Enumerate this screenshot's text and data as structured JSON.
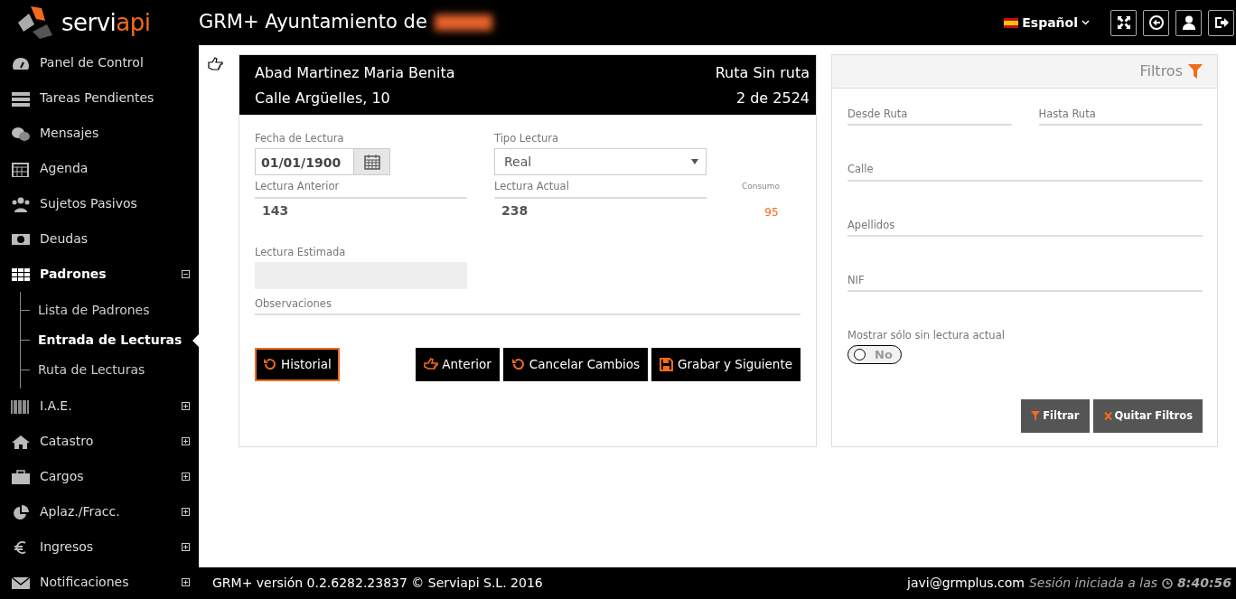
{
  "header": {
    "logo": {
      "part_1": "servi",
      "part_2": "api"
    },
    "title": "GRM+ Ayuntamiento de",
    "language": "Español"
  },
  "sidebar": {
    "items": [
      {
        "label": "Panel de Control",
        "kind": "link"
      },
      {
        "label": "Tareas Pendientes",
        "kind": "link"
      },
      {
        "label": "Mensajes",
        "kind": "link"
      },
      {
        "label": "Agenda",
        "kind": "link"
      },
      {
        "label": "Sujetos Pasivos",
        "kind": "link"
      },
      {
        "label": "Deudas",
        "kind": "link"
      },
      {
        "label": "Padrones",
        "kind": "group",
        "expanded": true,
        "children": [
          {
            "label": "Lista de Padrones",
            "selected": false
          },
          {
            "label": "Entrada de Lecturas",
            "selected": true
          },
          {
            "label": "Ruta de Lecturas",
            "selected": false
          }
        ]
      },
      {
        "label": "I.A.E.",
        "kind": "group",
        "expanded": false
      },
      {
        "label": "Catastro",
        "kind": "group",
        "expanded": false
      },
      {
        "label": "Cargos",
        "kind": "group",
        "expanded": false
      },
      {
        "label": "Aplaz./Fracc.",
        "kind": "group",
        "expanded": false
      },
      {
        "label": "Ingresos",
        "kind": "group",
        "expanded": false
      },
      {
        "label": "Notificaciones",
        "kind": "group",
        "expanded": false
      }
    ]
  },
  "record": {
    "name": "Abad Martinez Maria Benita",
    "address": "Calle Argüelles, 10",
    "route": "Ruta Sin ruta",
    "position": "2 de 2524",
    "fields": {
      "fecha": {
        "label": "Fecha de Lectura",
        "value": "01/01/1900"
      },
      "tipo": {
        "label": "Tipo Lectura",
        "value": "Real"
      },
      "anterior": {
        "label": "Lectura Anterior",
        "value": "143"
      },
      "actual": {
        "label": "Lectura Actual",
        "value": "238"
      },
      "consumo": {
        "label": "Consumo",
        "value": "95"
      },
      "estimada": {
        "label": "Lectura Estimada",
        "disabled": true
      },
      "observaciones": {
        "label": "Observaciones"
      }
    },
    "buttons": [
      {
        "label": "Historial",
        "focused": true
      },
      {
        "label": "Anterior",
        "focused": false
      },
      {
        "label": "Cancelar Cambios",
        "focused": false
      },
      {
        "label": "Grabar y Siguiente",
        "focused": false
      }
    ]
  },
  "filters": {
    "title": "Filtros",
    "fields": [
      {
        "label": "Desde Ruta"
      },
      {
        "label": "Hasta Ruta"
      },
      {
        "label": "Calle"
      },
      {
        "label": "Apellidos"
      },
      {
        "label": "NIF"
      }
    ],
    "toggle": {
      "label": "Mostrar sólo sin lectura actual",
      "on": false,
      "text": "No"
    },
    "buttons": [
      {
        "label": "Filtrar"
      },
      {
        "label": "Quitar Filtros"
      }
    ]
  },
  "footer": {
    "version": "GRM+ versión 0.2.6282.23837 © Serviapi S.L. 2016",
    "user": "javi@grmplus.com",
    "session": "Sesión iniciada a las",
    "time": "8:40:56"
  }
}
